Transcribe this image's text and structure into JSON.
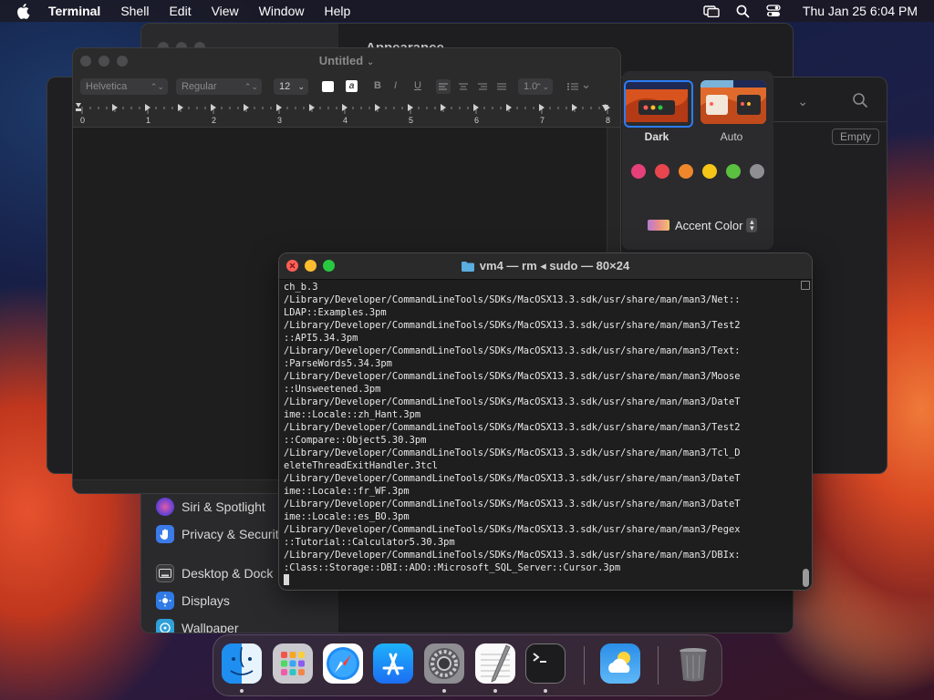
{
  "menubar": {
    "app_name": "Terminal",
    "items": [
      "Shell",
      "Edit",
      "View",
      "Window",
      "Help"
    ],
    "clock": "Thu Jan 25  6:04 PM"
  },
  "system_settings": {
    "title": "Appearance",
    "sidebar": [
      {
        "label": "Siri & Spotlight",
        "icon": "siri-icon",
        "color": "#6b3fd6"
      },
      {
        "label": "Privacy & Security",
        "icon": "hand-icon",
        "color": "#3b7be8"
      },
      {
        "label": "Desktop & Dock",
        "icon": "dock-icon",
        "color": "#3a3a3c"
      },
      {
        "label": "Displays",
        "icon": "displays-icon",
        "color": "#2f7ae5"
      },
      {
        "label": "Wallpaper",
        "icon": "wallpaper-icon",
        "color": "#2fa0d8"
      }
    ],
    "appearance_options": [
      {
        "label": "Dark",
        "selected": true
      },
      {
        "label": "Auto",
        "selected": false
      }
    ],
    "accent_colors": [
      "#e5407a",
      "#e8454f",
      "#f0872b",
      "#f5c518",
      "#5bbf3f",
      "#8e8e93"
    ],
    "accent_menu_label": "Accent Color"
  },
  "finder": {
    "empty_button": "Empty"
  },
  "textedit": {
    "title": "Untitled",
    "font_family": "Helvetica",
    "font_style": "Regular",
    "font_size": "12",
    "line_spacing": "1.0",
    "ruler_numbers": [
      "0",
      "1",
      "2",
      "3",
      "4",
      "5",
      "6",
      "7",
      "8"
    ]
  },
  "terminal": {
    "title": "vm4 — rm ◂ sudo — 80×24",
    "lines": [
      "ch_b.3",
      "/Library/Developer/CommandLineTools/SDKs/MacOSX13.3.sdk/usr/share/man/man3/Net::",
      "LDAP::Examples.3pm",
      "/Library/Developer/CommandLineTools/SDKs/MacOSX13.3.sdk/usr/share/man/man3/Test2",
      "::API5.34.3pm",
      "/Library/Developer/CommandLineTools/SDKs/MacOSX13.3.sdk/usr/share/man/man3/Text:",
      ":ParseWords5.34.3pm",
      "/Library/Developer/CommandLineTools/SDKs/MacOSX13.3.sdk/usr/share/man/man3/Moose",
      "::Unsweetened.3pm",
      "/Library/Developer/CommandLineTools/SDKs/MacOSX13.3.sdk/usr/share/man/man3/DateT",
      "ime::Locale::zh_Hant.3pm",
      "/Library/Developer/CommandLineTools/SDKs/MacOSX13.3.sdk/usr/share/man/man3/Test2",
      "::Compare::Object5.30.3pm",
      "/Library/Developer/CommandLineTools/SDKs/MacOSX13.3.sdk/usr/share/man/man3/Tcl_D",
      "eleteThreadExitHandler.3tcl",
      "/Library/Developer/CommandLineTools/SDKs/MacOSX13.3.sdk/usr/share/man/man3/DateT",
      "ime::Locale::fr_WF.3pm",
      "/Library/Developer/CommandLineTools/SDKs/MacOSX13.3.sdk/usr/share/man/man3/DateT",
      "ime::Locale::es_BO.3pm",
      "/Library/Developer/CommandLineTools/SDKs/MacOSX13.3.sdk/usr/share/man/man3/Pegex",
      "::Tutorial::Calculator5.30.3pm",
      "/Library/Developer/CommandLineTools/SDKs/MacOSX13.3.sdk/usr/share/man/man3/DBIx:",
      ":Class::Storage::DBI::ADO::Microsoft_SQL_Server::Cursor.3pm"
    ]
  },
  "dock": {
    "apps": [
      {
        "name": "finder-icon",
        "running": true
      },
      {
        "name": "launchpad-icon",
        "running": false
      },
      {
        "name": "safari-icon",
        "running": false
      },
      {
        "name": "app-store-icon",
        "running": false
      },
      {
        "name": "system-settings-icon",
        "running": true
      },
      {
        "name": "textedit-icon",
        "running": true
      },
      {
        "name": "terminal-icon",
        "running": true
      },
      {
        "name": "weather-icon",
        "running": false
      },
      {
        "name": "trash-icon",
        "running": false
      }
    ]
  }
}
